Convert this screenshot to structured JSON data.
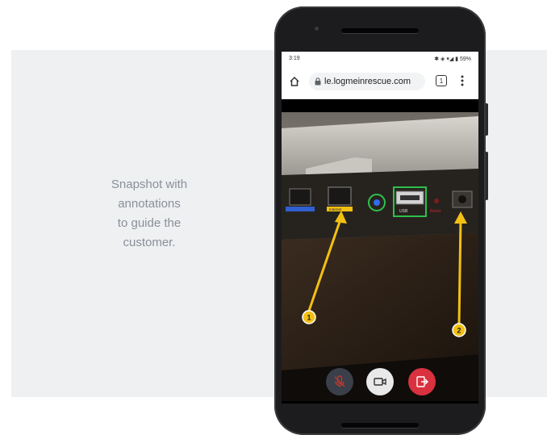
{
  "caption": {
    "lines": [
      "Snapshot with",
      "annotations",
      "to guide the",
      "customer."
    ]
  },
  "phone": {
    "status_bar": {
      "time": "3:19",
      "indicators": "✱ ◈ ▾◢ ▮ 59%"
    },
    "browser": {
      "url": "le.logmeinrescue.com",
      "tab_count": "1"
    },
    "camera_view": {
      "port_labels": {
        "internet": "Internet",
        "usb": "USB",
        "reset": "Reset"
      },
      "markers": [
        "1",
        "2"
      ]
    },
    "controls": {
      "mute": "mic-off-icon",
      "video": "video-camera-icon",
      "exit": "exit-session-icon"
    }
  },
  "colors": {
    "panel": "#eef0f2",
    "caption": "#8a9099",
    "arrow": "#f2c014",
    "highlight": "#2ec04b",
    "exit_button": "#d9313f"
  }
}
